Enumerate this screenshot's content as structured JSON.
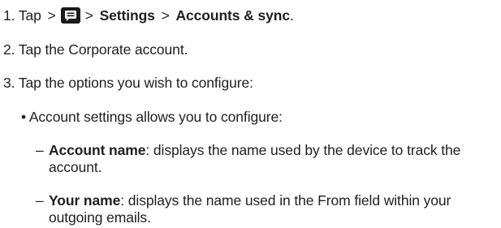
{
  "steps": {
    "step1": {
      "number": "1.",
      "tap": "Tap",
      "sep1": ">",
      "icon": "menu-icon",
      "sep2": ">",
      "settings": "Settings",
      "sep3": ">",
      "accounts_sync": "Accounts & sync",
      "period": "."
    },
    "step2": "2. Tap the Corporate account.",
    "step3": "3. Tap the options you wish to configure:"
  },
  "bullet": {
    "mark": "•",
    "text": "Account settings allows you to configure:"
  },
  "subitems": [
    {
      "dash": "–",
      "term": "Account name",
      "desc_line1": ": displays the name used by the device to track the",
      "desc_line2": "account."
    },
    {
      "dash": "–",
      "term": "Your name",
      "desc_line1": ": displays the name used in the From field within your",
      "desc_line2": "outgoing emails."
    }
  ]
}
